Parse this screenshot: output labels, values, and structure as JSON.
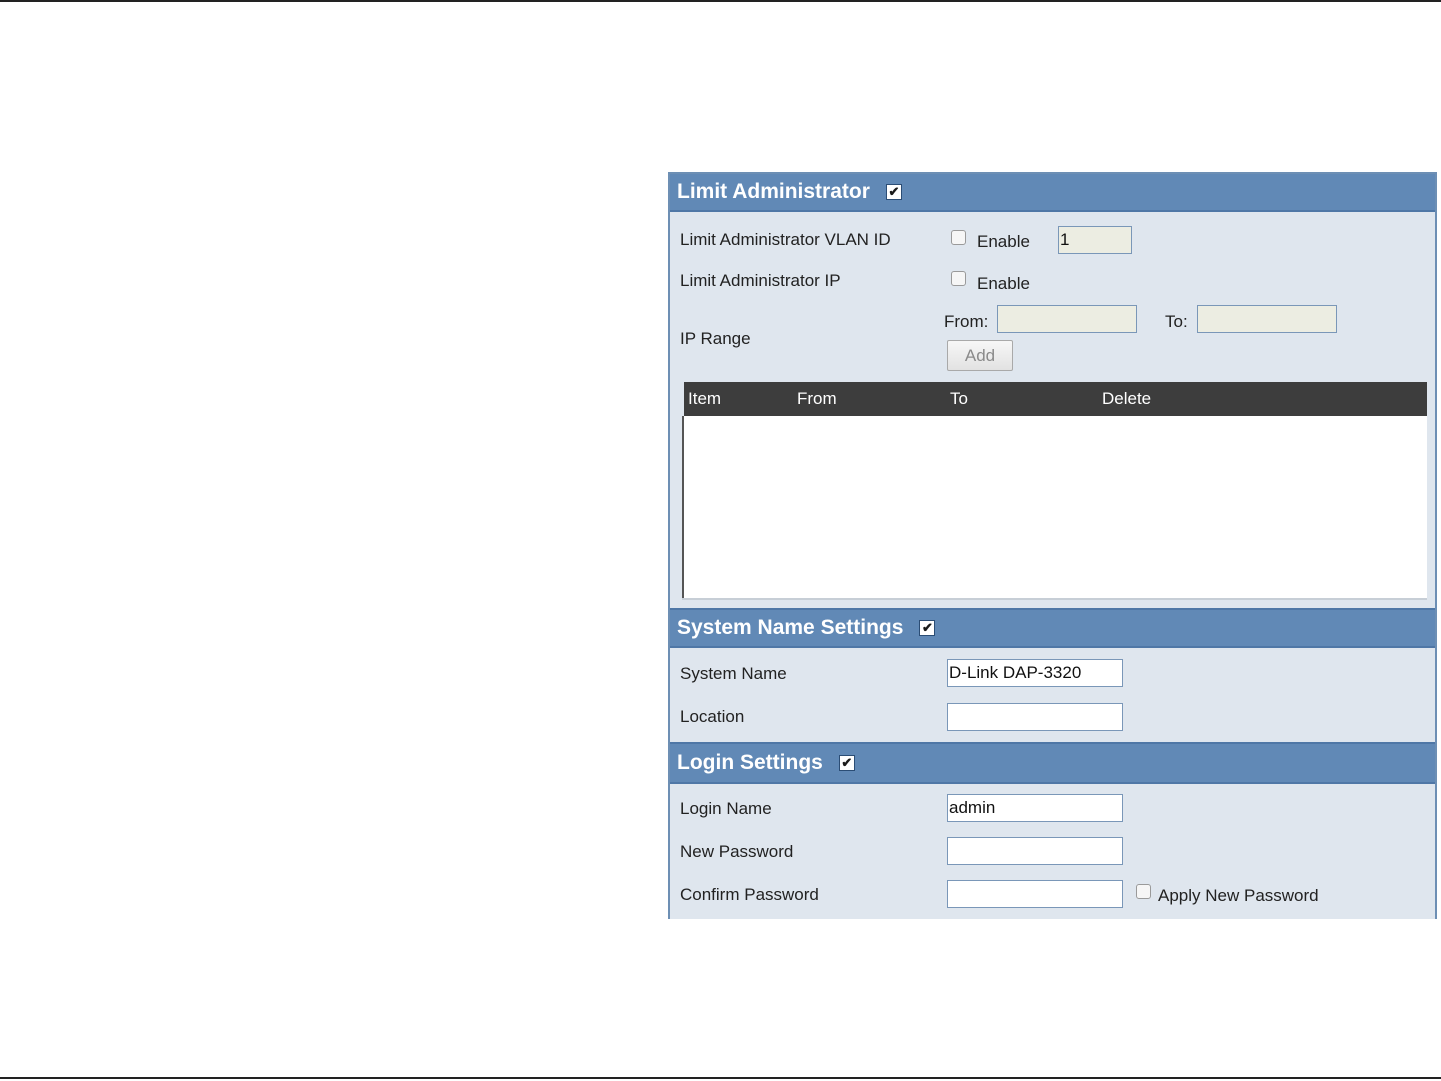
{
  "limit_admin": {
    "title": "Limit Administrator",
    "checked": true,
    "vlan_label": "Limit Administrator VLAN ID",
    "vlan_enable_label": "Enable",
    "vlan_value": "1",
    "ip_label": "Limit Administrator IP",
    "ip_enable_label": "Enable",
    "ip_range_label": "IP Range",
    "from_label": "From:",
    "to_label": "To:",
    "from_value": "",
    "to_value": "",
    "add_label": "Add",
    "table": {
      "columns": [
        "Item",
        "From",
        "To",
        "Delete"
      ],
      "rows": []
    }
  },
  "system_name": {
    "title": "System Name Settings",
    "checked": true,
    "name_label": "System Name",
    "name_value": "D-Link DAP-3320",
    "location_label": "Location",
    "location_value": ""
  },
  "login": {
    "title": "Login Settings",
    "checked": true,
    "login_name_label": "Login Name",
    "login_name_value": "admin",
    "new_password_label": "New Password",
    "new_password_value": "",
    "confirm_password_label": "Confirm Password",
    "confirm_password_value": "",
    "apply_label": "Apply New Password"
  },
  "icons": {
    "checkmark": "check-icon"
  }
}
